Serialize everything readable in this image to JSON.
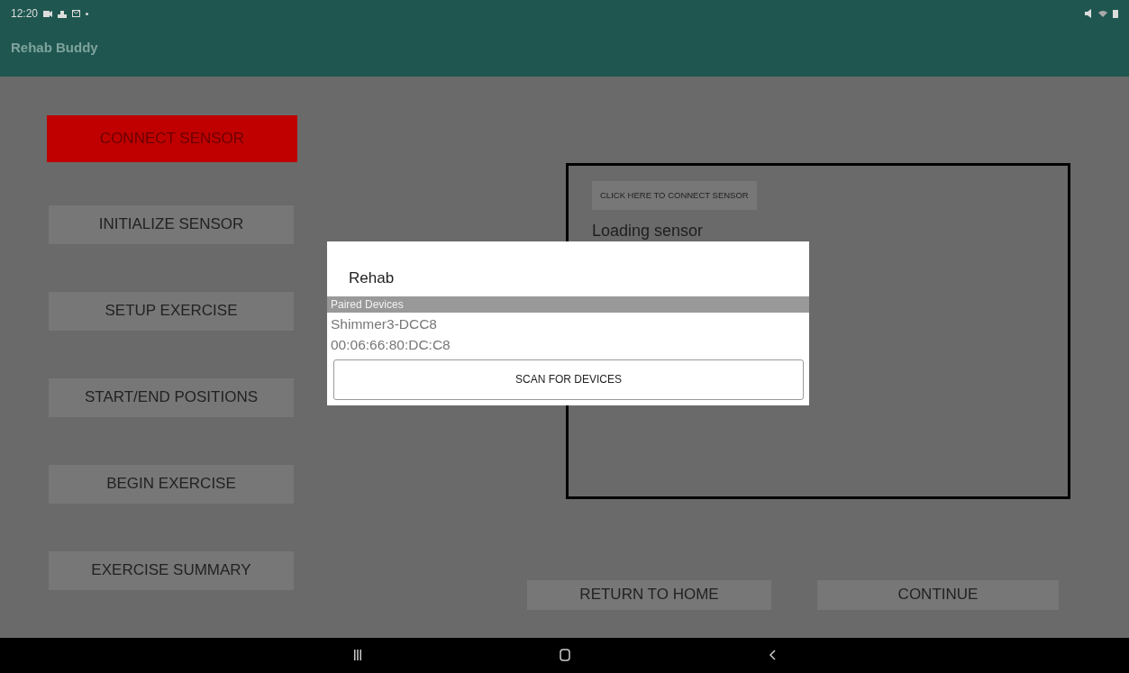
{
  "status_bar": {
    "time": "12:20"
  },
  "app_bar": {
    "title": "Rehab Buddy"
  },
  "sidebar": {
    "buttons": [
      {
        "label": "CONNECT SENSOR",
        "highlighted": true
      },
      {
        "label": "INITIALIZE SENSOR",
        "highlighted": false
      },
      {
        "label": "SETUP EXERCISE",
        "highlighted": false
      },
      {
        "label": "START/END POSITIONS",
        "highlighted": false
      },
      {
        "label": "BEGIN EXERCISE",
        "highlighted": false
      },
      {
        "label": "EXERCISE SUMMARY",
        "highlighted": false
      }
    ]
  },
  "sensor_panel": {
    "connect_button": "CLICK HERE TO CONNECT SENSOR",
    "status": "Loading sensor"
  },
  "footer_buttons": [
    "RETURN TO HOME",
    "CONTINUE"
  ],
  "dialog": {
    "title": "Rehab",
    "section": "Paired Devices",
    "devices": [
      {
        "name": "Shimmer3-DCC8",
        "address": "00:06:66:80:DC:C8"
      }
    ],
    "scan_button": "SCAN FOR DEVICES"
  }
}
